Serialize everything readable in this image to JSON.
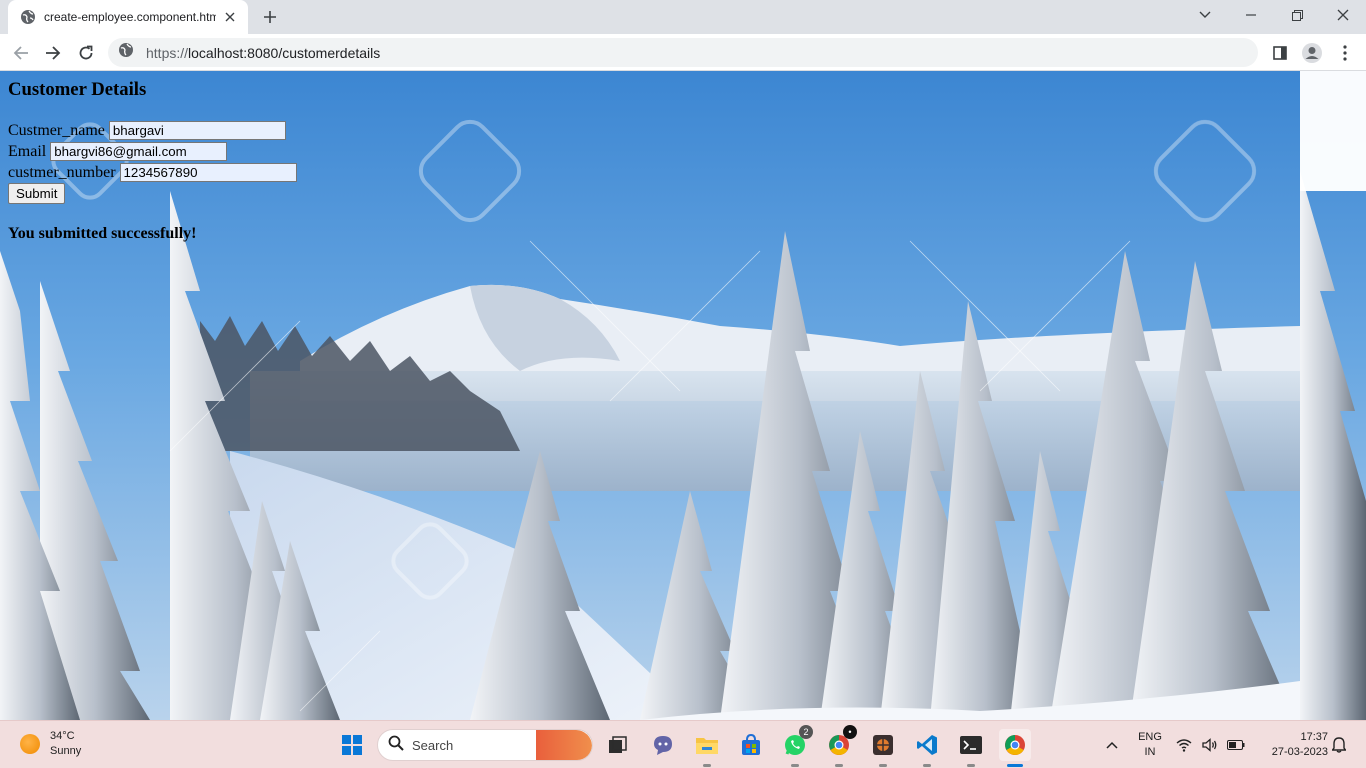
{
  "browser": {
    "tab_title": "create-employee.component.htm",
    "url_scheme": "https://",
    "url_rest": "localhost:8080/customerdetails"
  },
  "page": {
    "heading": "Customer Details",
    "fields": {
      "name_label": "Custmer_name",
      "name_value": "bhargavi",
      "email_label": "Email",
      "email_value": "bhargvi86@gmail.com",
      "number_label": "custmer_number",
      "number_value": "1234567890"
    },
    "submit_label": "Submit",
    "success_message": "You submitted successfully!"
  },
  "taskbar": {
    "weather_temp": "34°C",
    "weather_desc": "Sunny",
    "search_placeholder": "Search",
    "whatsapp_badge": "2",
    "language_line1": "ENG",
    "language_line2": "IN",
    "time": "17:37",
    "date": "27-03-2023"
  },
  "colors": {
    "sky": "#4a8fd6",
    "snow": "#eef3f8",
    "taskbar": "#f2dede"
  }
}
